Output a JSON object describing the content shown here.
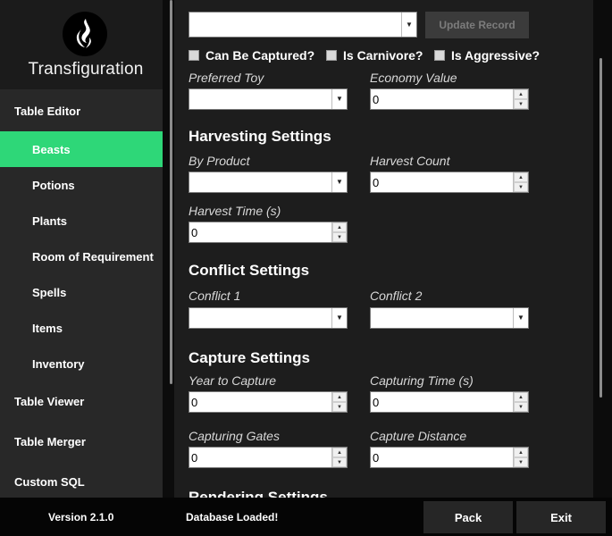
{
  "app": {
    "title": "Transfiguration"
  },
  "sidebar": {
    "table_editor": "Table Editor",
    "items": [
      "Beasts",
      "Potions",
      "Plants",
      "Room of Requirement",
      "Spells",
      "Items",
      "Inventory"
    ],
    "table_viewer": "Table Viewer",
    "table_merger": "Table Merger",
    "custom_sql": "Custom SQL"
  },
  "form": {
    "record_select_value": "",
    "update_button": "Update Record",
    "checkboxes": {
      "can_be_captured": "Can Be Captured?",
      "is_carnivore": "Is Carnivore?",
      "is_aggressive": "Is Aggressive?"
    },
    "preferred_toy": {
      "label": "Preferred Toy",
      "value": ""
    },
    "economy_value": {
      "label": "Economy Value",
      "value": "0"
    },
    "harvesting": {
      "title": "Harvesting Settings",
      "by_product": {
        "label": "By Product",
        "value": ""
      },
      "harvest_count": {
        "label": "Harvest Count",
        "value": "0"
      },
      "harvest_time": {
        "label": "Harvest Time (s)",
        "value": "0"
      }
    },
    "conflict": {
      "title": "Conflict Settings",
      "conflict_1": {
        "label": "Conflict 1",
        "value": ""
      },
      "conflict_2": {
        "label": "Conflict 2",
        "value": ""
      }
    },
    "capture": {
      "title": "Capture Settings",
      "year_to_capture": {
        "label": "Year to Capture",
        "value": "0"
      },
      "capturing_time": {
        "label": "Capturing Time (s)",
        "value": "0"
      },
      "capturing_gates": {
        "label": "Capturing Gates",
        "value": "0"
      },
      "capture_distance": {
        "label": "Capture Distance",
        "value": "0"
      }
    },
    "rendering": {
      "title": "Rendering Settings"
    }
  },
  "status": {
    "version": "Version 2.1.0",
    "message": "Database Loaded!",
    "pack_button": "Pack",
    "exit_button": "Exit"
  },
  "colors": {
    "accent": "#2ed778",
    "sidebar": "#282828",
    "content": "#1d1d1d"
  },
  "icons": {
    "logo": "flame-logo-icon",
    "dropdown": "chevron-down-icon",
    "spin_up": "triangle-up-icon",
    "spin_down": "triangle-down-icon"
  }
}
